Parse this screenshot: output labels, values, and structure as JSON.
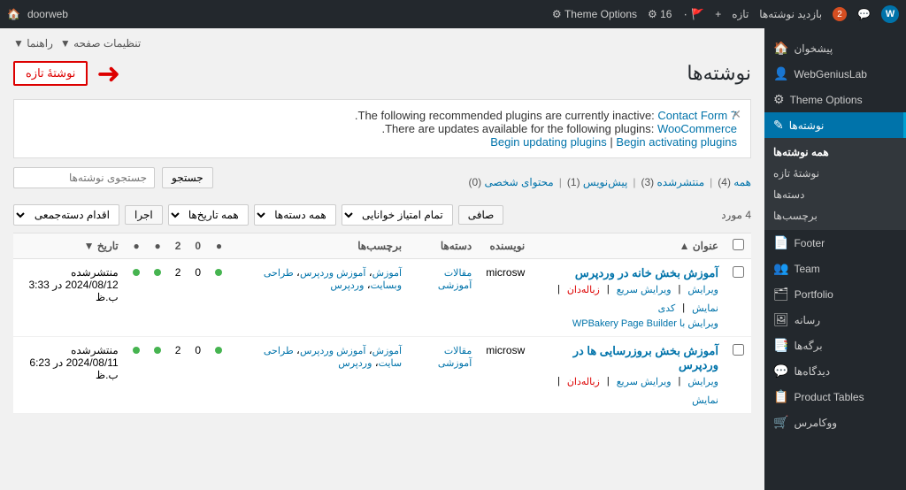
{
  "adminBar": {
    "siteName": "doorweb",
    "badge": "2",
    "menuItems": [
      "بازدید نوشته‌ها",
      "تازه",
      "+",
      "۰",
      "16",
      "Theme Options",
      "doorweb"
    ],
    "wpLabel": "W"
  },
  "sidebar": {
    "items": [
      {
        "label": "پیشخوان",
        "icon": "🏠",
        "active": false
      },
      {
        "label": "WebGeniusLab",
        "icon": "👤",
        "active": false
      },
      {
        "label": "Theme Options",
        "icon": "⚙",
        "active": false
      },
      {
        "label": "نوشته‌ها",
        "icon": "✎",
        "active": true
      }
    ],
    "subItems": [
      {
        "label": "همه نوشته‌ها",
        "active": true
      },
      {
        "label": "نوشتهٔ تازه",
        "active": false
      },
      {
        "label": "دسته‌ها",
        "active": false
      },
      {
        "label": "برچسب‌ها",
        "active": false
      }
    ],
    "bottomItems": [
      {
        "label": "Footer",
        "icon": "📄"
      },
      {
        "label": "Team",
        "icon": "👥"
      },
      {
        "label": "Portfolio",
        "icon": "🗂"
      },
      {
        "label": "رسانه",
        "icon": "🖼"
      },
      {
        "label": "برگه‌ها",
        "icon": "📑"
      },
      {
        "label": "دیدگاه‌ها",
        "icon": "💬"
      },
      {
        "label": "Product Tables",
        "icon": "📋"
      },
      {
        "label": "ووکامرس",
        "icon": "🛒"
      }
    ]
  },
  "topNav": [
    {
      "label": "تنظیمات صفحه ▼"
    },
    {
      "label": "راهنما ▼"
    }
  ],
  "pageTitle": "نوشته‌ها",
  "newPostBtn": "نوشتهٔ تازه",
  "notice": {
    "line1": "The following recommended plugins are currently inactive: Contact Form 7.",
    "line2": "There are updates available for the following plugins: WooCommerce.",
    "line3Parts": [
      "Begin updating plugins",
      " | ",
      "Begin activating plugins"
    ]
  },
  "tabs": [
    {
      "label": "همه",
      "count": "(4)",
      "active": true
    },
    {
      "label": "منتشرشده",
      "count": "(3)"
    },
    {
      "label": "پیش‌نویس",
      "count": "(1)"
    },
    {
      "label": "محتوای شخصی",
      "count": "(0)"
    }
  ],
  "searchPlaceholder": "جستجوی نوشته‌ها",
  "searchBtn": "جستجو",
  "actionBarSelects": [
    {
      "label": "اقدام دسته‌جمعی ▼"
    },
    {
      "label": "همه تاریخ‌ها ▼"
    },
    {
      "label": "همه دسته‌ها ▼"
    },
    {
      "label": "تمام امتیاز خوانایی ▼"
    }
  ],
  "applyBtn": "اجرا",
  "filterBtn": "صافی",
  "countLabel": "4 مورد",
  "tableHeaders": [
    "عنوان ▲",
    "نویسنده",
    "دسته‌ها",
    "برچسب‌ها",
    "●",
    "تاریخ",
    "",
    "",
    "",
    ""
  ],
  "posts": [
    {
      "title": "آموزش بخش خانه در وردپرس",
      "author": "microsw",
      "category": "مقالات آموزشی",
      "tags": "آموزش، آموزش وردپرس، طراحی وبسایت، وردپرس",
      "status": "منتشرشده",
      "date": "2024/08/12 در 3:33 ب.ظ",
      "comments": "2",
      "likes": "0",
      "actions": [
        "ویرایش",
        "ویرایش سریع",
        "زباله‌دان",
        "نمایش",
        "کدی",
        "ویرایش با WPBakery Page Builder"
      ]
    },
    {
      "title": "آموزش بخش بروزرسایی ها در وردپرس",
      "author": "microsw",
      "category": "مقالات آموزشی",
      "tags": "آموزش، آموزش وردپرس، طراحی سایت، وردپرس",
      "status": "منتشرشده",
      "date": "2024/08/11 در 6:23 ب.ظ",
      "comments": "2",
      "likes": "0",
      "actions": [
        "ویرایش",
        "ویرایش سریع",
        "زباله‌دان",
        "نمایش"
      ]
    }
  ]
}
